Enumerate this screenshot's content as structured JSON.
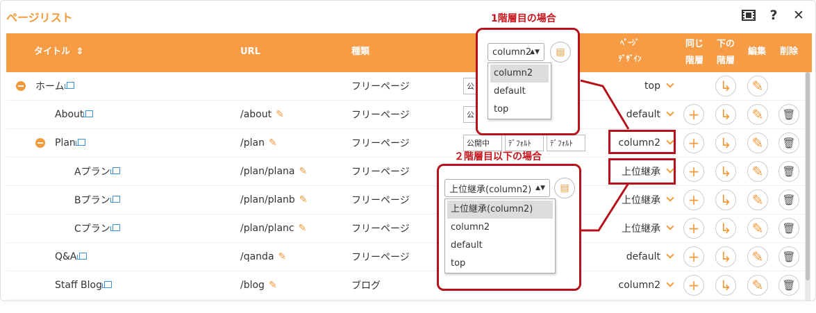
{
  "panel": {
    "title": "ページリスト"
  },
  "toolbar_icons": [
    "film-icon",
    "help-icon",
    "close-icon"
  ],
  "help_glyph": "?",
  "close_glyph": "✕",
  "header": {
    "title": "タイトル",
    "sort_glyph": "⇕",
    "url": "URL",
    "kind": "種類",
    "design1": "ﾍﾟｰｼﾞ",
    "design2": "ﾃﾞｻﾞｲﾝ",
    "same1": "同じ",
    "same2": "階層",
    "below1": "下の",
    "below2": "階層",
    "edit": "編集",
    "delete": "削除"
  },
  "rows": [
    {
      "title": "ホーム",
      "url": "",
      "kind": "フリーページ",
      "design": "top",
      "expand": true
    },
    {
      "title": "About",
      "url": "/about",
      "kind": "フリーページ",
      "design": "default"
    },
    {
      "title": "Plan",
      "url": "/plan",
      "kind": "フリーページ",
      "design": "column2",
      "expand": true
    },
    {
      "title": "Aプラン",
      "url": "/plan/plana",
      "kind": "フリーページ",
      "design": "上位継承"
    },
    {
      "title": "Bプラン",
      "url": "/plan/planb",
      "kind": "フリーページ",
      "design": "上位継承"
    },
    {
      "title": "Cプラン",
      "url": "/plan/planc",
      "kind": "フリーページ",
      "design": "上位継承"
    },
    {
      "title": "Q&A",
      "url": "/qanda",
      "kind": "フリーページ",
      "design": "default"
    },
    {
      "title": "Staff Blog",
      "url": "/blog",
      "kind": "ブログ",
      "design": "column2"
    }
  ],
  "status_cells": {
    "public": "公開中",
    "default1": "ﾃﾞﾌｫﾙﾄ",
    "default2": "ﾃﾞﾌｫﾙﾄ"
  },
  "partial_texts": {
    "kou1": "公",
    "kou2": "公",
    "shou1": "承",
    "shou2": "承",
    "shou3": "承",
    "shou4": "承",
    "lt": "lt"
  },
  "callout1": {
    "label": "1階層目の場合",
    "selected": "column2",
    "options": [
      "column2",
      "default",
      "top"
    ]
  },
  "callout2": {
    "label": "２階層目以下の場合",
    "selected": "上位継承(column2)",
    "options": [
      "上位継承(column2)",
      "column2",
      "default",
      "top"
    ]
  },
  "colors": {
    "accent": "#f59c45",
    "annotation": "#b5121b"
  }
}
